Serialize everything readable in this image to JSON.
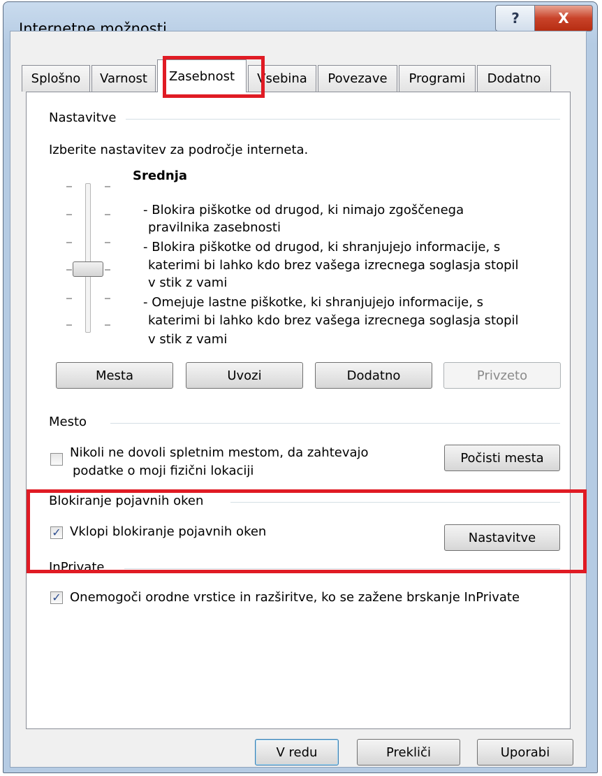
{
  "window": {
    "title": "Internetne možnosti",
    "help": "?",
    "close": "X"
  },
  "tabs": [
    "Splošno",
    "Varnost",
    "Zasebnost",
    "Vsebina",
    "Povezave",
    "Programi",
    "Dodatno"
  ],
  "active_tab": "Zasebnost",
  "settings": {
    "group_label": "Nastavitve",
    "prompt": "Izberite nastavitev za področje interneta.",
    "level": "Srednja",
    "desc": [
      "- Blokira piškotke od drugod, ki nimajo zgoščenega",
      "pravilnika zasebnosti",
      "- Blokira piškotke od drugod, ki shranjujejo informacije, s",
      "katerimi bi lahko kdo brez vašega izrecnega soglasja stopil",
      "v stik z vami",
      "- Omejuje lastne piškotke, ki shranjujejo informacije, s",
      "katerimi bi lahko kdo brez vašega izrecnega soglasja stopil",
      "v stik z vami"
    ],
    "buttons": {
      "sites": "Mesta",
      "import": "Uvozi",
      "advanced": "Dodatno",
      "default": "Privzeto"
    }
  },
  "location": {
    "group_label": "Mesto",
    "checkbox_line1": "Nikoli ne dovoli spletnim mestom, da zahtevajo",
    "checkbox_line2": "podatke o moji fizični lokaciji",
    "checked": false,
    "clear_button": "Počisti mesta"
  },
  "popup": {
    "group_label": "Blokiranje pojavnih oken",
    "checkbox_label": "Vklopi blokiranje pojavnih oken",
    "checked": true,
    "settings_button": "Nastavitve"
  },
  "inprivate": {
    "group_label": "InPrivate",
    "checkbox_label": "Onemogoči orodne vrstice in razširitve, ko se zažene brskanje InPrivate",
    "checked": true
  },
  "footer": {
    "ok": "V redu",
    "cancel": "Prekliči",
    "apply": "Uporabi"
  },
  "colors": {
    "highlight_box": "#e01b24",
    "check_mark": "#2d4d8f"
  }
}
